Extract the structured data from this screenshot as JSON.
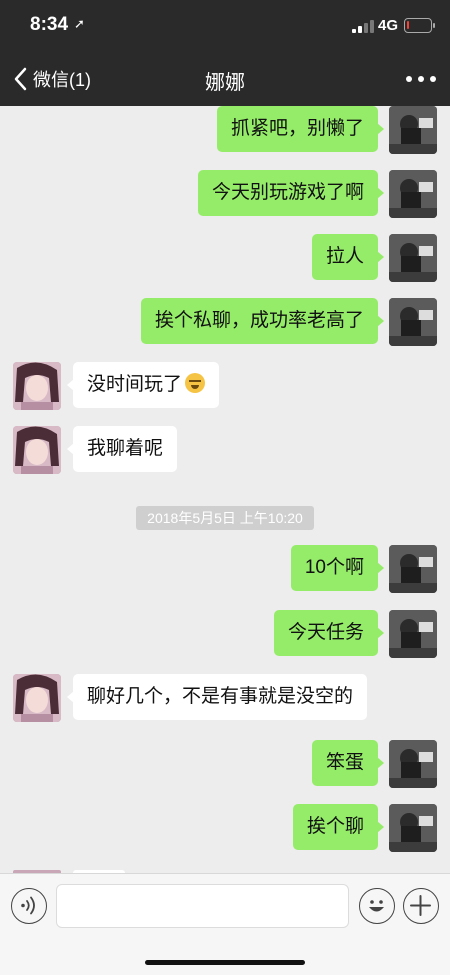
{
  "status_bar": {
    "time": "8:34",
    "network": "4G",
    "battery_level_fraction": 0.1,
    "signal_bars_active": 2,
    "signal_bars_total": 4
  },
  "nav": {
    "back_label": "微信(1)",
    "title": "娜娜"
  },
  "messages": [
    {
      "side": "sent",
      "text": "抓紧吧，别懒了"
    },
    {
      "side": "sent",
      "text": "今天别玩游戏了啊"
    },
    {
      "side": "sent",
      "text": "拉人"
    },
    {
      "side": "sent",
      "text": "挨个私聊，成功率老高了"
    },
    {
      "side": "received",
      "text": "没时间玩了",
      "emoji": "sweat-smile-emoji"
    },
    {
      "side": "received",
      "text": "我聊着呢"
    },
    {
      "side": "sent",
      "text": "10个啊"
    },
    {
      "side": "sent",
      "text": "今天任务"
    },
    {
      "side": "received",
      "text": "聊好几个，不是有事就是没空的"
    },
    {
      "side": "sent",
      "text": "笨蛋"
    },
    {
      "side": "sent",
      "text": "挨个聊"
    }
  ],
  "timestamp": "2018年5月5日 上午10:20",
  "input": {
    "value": "",
    "placeholder": ""
  },
  "icons": {
    "voice": "voice-icon",
    "emoji": "emoji-face-icon",
    "plus": "plus-icon",
    "back": "chevron-left-icon",
    "more": "more-dots-icon",
    "location": "location-arrow-icon"
  },
  "colors": {
    "sent_bubble": "#95ec69",
    "received_bubble": "#ffffff",
    "header": "#2a2a2a",
    "chat_background": "#ededed",
    "battery_low": "#f44336"
  }
}
